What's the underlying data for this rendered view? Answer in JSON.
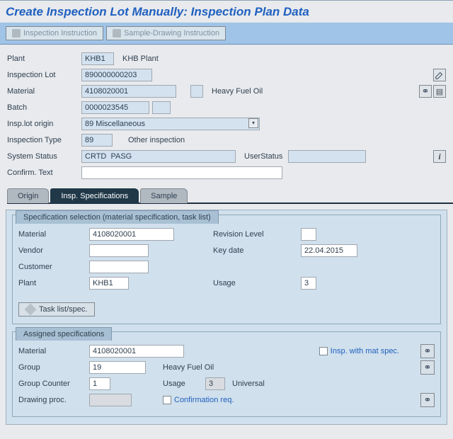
{
  "title": "Create Inspection Lot Manually: Inspection Plan Data",
  "toolbar": {
    "inspection_instruction": "Inspection Instruction",
    "sample_drawing_instruction": "Sample-Drawing Instruction"
  },
  "header": {
    "plant_label": "Plant",
    "plant_value": "KHB1",
    "plant_desc": "KHB Plant",
    "inspection_lot_label": "Inspection Lot",
    "inspection_lot_value": "890000000203",
    "material_label": "Material",
    "material_value": "4108020001",
    "material_desc": "Heavy Fuel Oil",
    "batch_label": "Batch",
    "batch_value": "0000023545",
    "origin_label": "Insp.lot origin",
    "origin_value": "89 Miscellaneous",
    "type_label": "Inspection Type",
    "type_value": "89",
    "type_desc": "Other inspection",
    "sysstat_label": "System Status",
    "sysstat_value": "CRTD  PASG",
    "userstat_label": "UserStatus",
    "userstat_value": "",
    "confirm_label": "Confirm. Text",
    "confirm_value": ""
  },
  "tabs": {
    "origin": "Origin",
    "insp_spec": "Insp. Specifications",
    "sample": "Sample"
  },
  "spec_sel": {
    "title": "Specification selection (material specification, task list)",
    "material_label": "Material",
    "material_value": "4108020001",
    "vendor_label": "Vendor",
    "vendor_value": "",
    "customer_label": "Customer",
    "customer_value": "",
    "plant_label": "Plant",
    "plant_value": "KHB1",
    "rev_label": "Revision Level",
    "rev_value": "",
    "keydate_label": "Key date",
    "keydate_value": "22.04.2015",
    "usage_label": "Usage",
    "usage_value": "3",
    "task_list_btn": "Task list/spec."
  },
  "assigned": {
    "title": "Assigned specifications",
    "material_label": "Material",
    "material_value": "4108020001",
    "insp_mat_spec": "Insp. with mat spec.",
    "group_label": "Group",
    "group_value": "19",
    "group_desc": "Heavy Fuel Oil",
    "counter_label": "Group Counter",
    "counter_value": "1",
    "usage_label": "Usage",
    "usage_value": "3",
    "usage_desc": "Universal",
    "drawing_label": "Drawing proc.",
    "drawing_value": "",
    "confirm_req": "Confirmation req."
  }
}
